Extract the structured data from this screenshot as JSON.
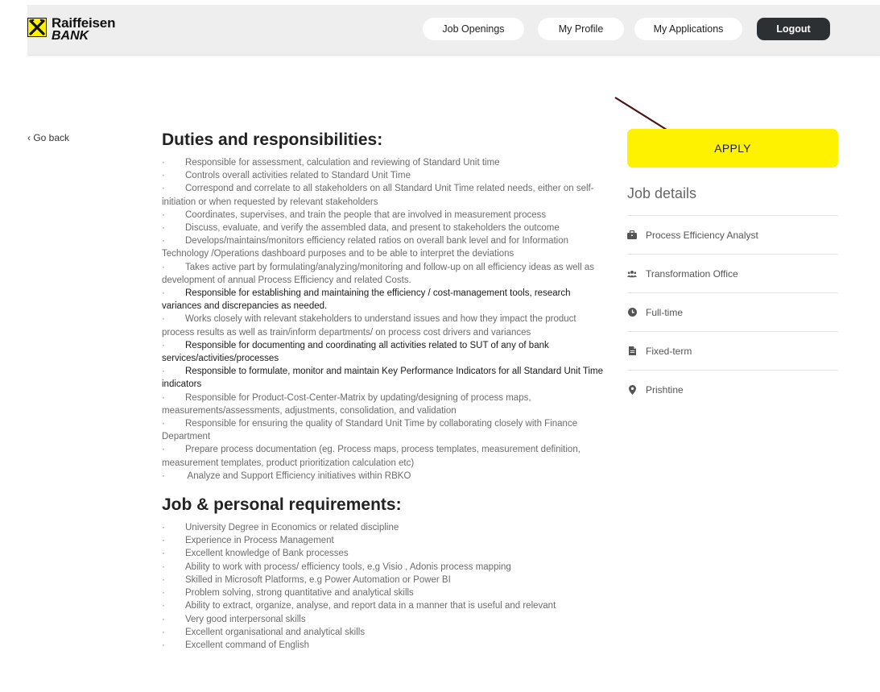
{
  "brand": {
    "line1": "Raiffeisen",
    "line2": "BANK",
    "color": "#fff200"
  },
  "nav": {
    "job_openings": "Job Openings",
    "my_profile": "My Profile",
    "my_applications": "My Applications",
    "logout": "Logout"
  },
  "go_back": "Go back",
  "duties": {
    "title": "Duties and responsibilities:",
    "items": [
      "Responsible for assessment, calculation and reviewing of Standard Unit time",
      "Controls overall activities related to Standard Unit Time",
      "Correspond and correlate to all stakeholders on all Standard Unit Time related needs, either on self-initiation or when requested by relevant stakeholders",
      "Coordinates, supervises, and train the people that are involved in measurement process",
      "Discuss, evaluate, and verify the assembled data, and present to stakeholders the outcome",
      "Develops/maintains/monitors efficiency related ratios on overall bank level and for Information Technology /Operations dashboard purposes and to be able to interpret the deviations",
      "Takes active part by formulating/analyzing/monitoring and follow-up on all efficiency ideas as well as development of annual Process Efficiency and related Costs.",
      "Responsible for establishing and maintaining the efficiency / cost-management tools, research variances and discrepancies as needed.",
      "Works closely with relevant stakeholders to understand issues and how they impact the product process results as well as train/inform departments/ on process cost drivers and variances",
      "Responsible for documenting and coordinating all activities related to SUT of any of bank services/activities/processes",
      "Responsible to formulate, monitor and maintain Key Performance Indicators for all Standard Unit Time indicators",
      "Responsible for Product-Cost-Center-Matrix by updating/designing of process maps, measurements/assessments, adjustments, consolidation, and validation",
      "Responsible for ensuring the quality of Standard Unit Time by collaborating closely with  Finance Department",
      "Prepare process documentation (eg. Process maps, process templates, measurement definition, measurement templates, product prioritization calculation etc)",
      " Analyze and Support Efficiency initiatives within RBKO"
    ]
  },
  "requirements": {
    "title": "Job & personal requirements:",
    "items": [
      "University Degree in Economics or related discipline",
      "Experience in Process Management",
      "Excellent knowledge of Bank processes",
      "Ability to work with process/ efficiency tools, e,g Visio , Adonis process mapping",
      "Skilled in Microsoft Platforms, e.g Power Automation or Power BI",
      "Problem solving, strong quantitative and analytical skills",
      "Ability to extract, organize, analyse, and report data in a manner that is useful and relevant",
      "Very good interpersonal skills",
      "Excellent organisational and analytical skills",
      "Excellent command of English"
    ]
  },
  "bullet_char": "·",
  "apply": "APPLY",
  "job_details": {
    "title": "Job details",
    "items": [
      {
        "icon": "briefcase-icon",
        "label": "Process Efficiency Analyst"
      },
      {
        "icon": "users-icon",
        "label": "Transformation Office"
      },
      {
        "icon": "clock-icon",
        "label": "Full-time"
      },
      {
        "icon": "document-icon",
        "label": "Fixed-term"
      },
      {
        "icon": "location-pin-icon",
        "label": "Prishtine"
      }
    ]
  }
}
